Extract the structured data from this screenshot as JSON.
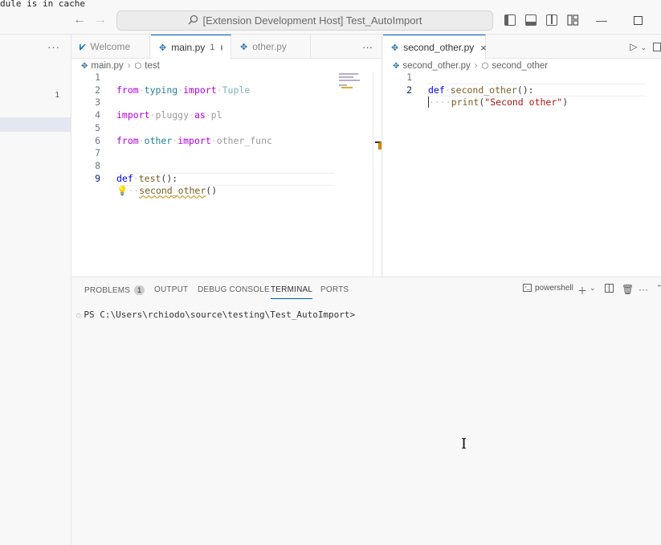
{
  "overlay_text": "dule is in cache",
  "titlebar": {
    "command_center": "[Extension Development Host] Test_AutoImport",
    "icons": [
      "back-arrow-icon",
      "forward-arrow-icon",
      "search-icon",
      "toggle-primary-sidebar-icon",
      "toggle-panel-icon",
      "toggle-secondary-sidebar-icon",
      "customize-layout-icon",
      "minimize-icon",
      "maximize-icon"
    ]
  },
  "sidebar": {
    "more": "···",
    "count": "1"
  },
  "group1": {
    "tabs": [
      {
        "label": "Welcome",
        "icon": "vscode-icon"
      },
      {
        "label": "main.py",
        "icon": "python-icon",
        "badge": "1",
        "dirty": true,
        "active": true
      },
      {
        "label": "other.py",
        "icon": "python-icon"
      }
    ],
    "more": "···",
    "breadcrumb": {
      "file": "main.py",
      "symbol": "test"
    },
    "lines": [
      {
        "n": "1"
      },
      {
        "n": "2"
      },
      {
        "n": "3"
      },
      {
        "n": "4"
      },
      {
        "n": "5"
      },
      {
        "n": "6"
      },
      {
        "n": "7"
      },
      {
        "n": "8"
      },
      {
        "n": "9"
      }
    ],
    "code": {
      "l1_kw": "from",
      "l1_mod": "typing",
      "l1_kw2": "import",
      "l1_name": "Tuple",
      "l3_kw": "import",
      "l3_mod": "pluggy",
      "l3_kw2": "as",
      "l3_alias": "pl",
      "l5_kw": "from",
      "l5_mod": "other",
      "l5_kw2": "import",
      "l5_name": "other_func",
      "l8_kw": "def",
      "l8_fn": "test",
      "l8_rest": "():",
      "l9_fn": "second_other",
      "l9_rest": "()"
    }
  },
  "group2": {
    "tab": {
      "label": "second_other.py",
      "icon": "python-icon",
      "close": "×"
    },
    "breadcrumb": {
      "file": "second_other.py",
      "symbol": "second_other"
    },
    "lines": [
      {
        "n": "1"
      },
      {
        "n": "2"
      }
    ],
    "code": {
      "l1_kw": "def",
      "l1_fn": "second_other",
      "l1_rest": "():",
      "l2_fn": "print",
      "l2_open": "(",
      "l2_str": "\"Second other\"",
      "l2_close": ")"
    }
  },
  "panel": {
    "tabs": [
      {
        "label": "PROBLEMS",
        "badge": "1"
      },
      {
        "label": "OUTPUT"
      },
      {
        "label": "DEBUG CONSOLE"
      },
      {
        "label": "TERMINAL",
        "active": true
      },
      {
        "label": "PORTS"
      }
    ],
    "shell": "powershell",
    "prompt": "PS C:\\Users\\rchiodo\\source\\testing\\Test_AutoImport>"
  }
}
